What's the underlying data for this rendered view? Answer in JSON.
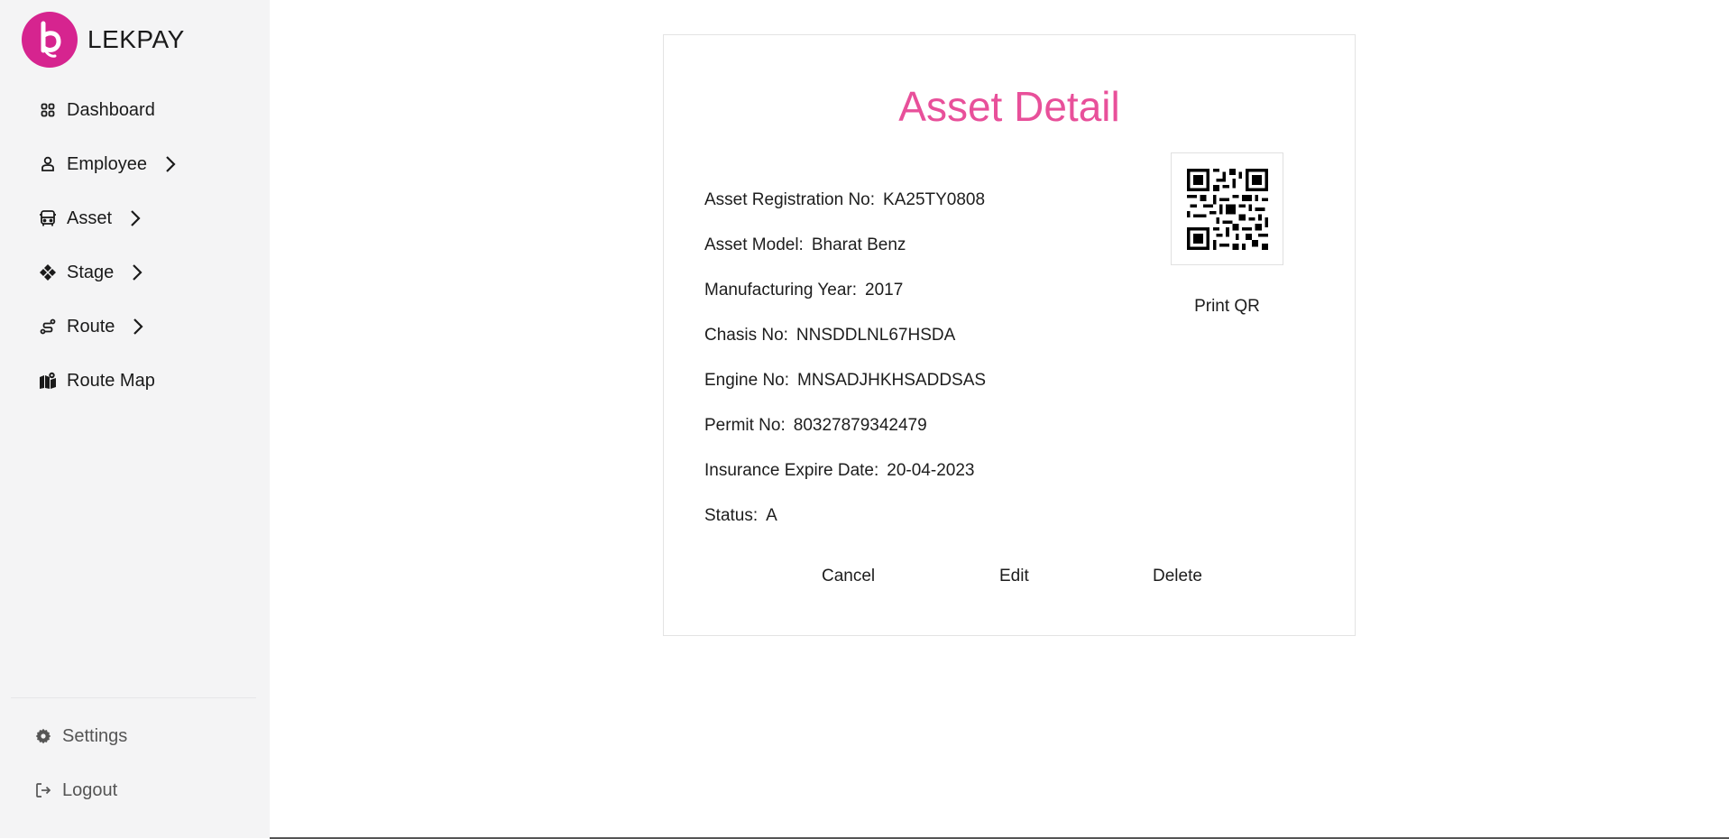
{
  "brand": {
    "name": "LEKPAY",
    "accent": "#d6248f"
  },
  "sidebar": {
    "items": [
      {
        "label": "Dashboard",
        "icon": "dashboard-grid-icon",
        "has_children": false
      },
      {
        "label": "Employee",
        "icon": "user-icon",
        "has_children": true
      },
      {
        "label": "Asset",
        "icon": "bus-icon",
        "has_children": true
      },
      {
        "label": "Stage",
        "icon": "diamond-grid-icon",
        "has_children": true
      },
      {
        "label": "Route",
        "icon": "route-icon",
        "has_children": true
      },
      {
        "label": "Route Map",
        "icon": "map-icon",
        "has_children": false
      }
    ],
    "footer": [
      {
        "label": "Settings",
        "icon": "gear-icon"
      },
      {
        "label": "Logout",
        "icon": "logout-icon"
      }
    ]
  },
  "detail": {
    "title": "Asset Detail",
    "title_color": "#e8509a",
    "fields": [
      {
        "label": "Asset Registration No:",
        "value": "KA25TY0808"
      },
      {
        "label": "Asset Model:",
        "value": "Bharat Benz"
      },
      {
        "label": "Manufacturing Year:",
        "value": "2017"
      },
      {
        "label": "Chasis No:",
        "value": "NNSDDLNL67HSDA"
      },
      {
        "label": "Engine No:",
        "value": "MNSADJHKHSADDSAS"
      },
      {
        "label": "Permit No:",
        "value": "80327879342479"
      },
      {
        "label": "Insurance Expire Date:",
        "value": "20-04-2023"
      },
      {
        "label": "Status:",
        "value": "A"
      }
    ],
    "print_qr_label": "Print QR",
    "actions": {
      "cancel": "Cancel",
      "edit": "Edit",
      "delete": "Delete"
    }
  }
}
